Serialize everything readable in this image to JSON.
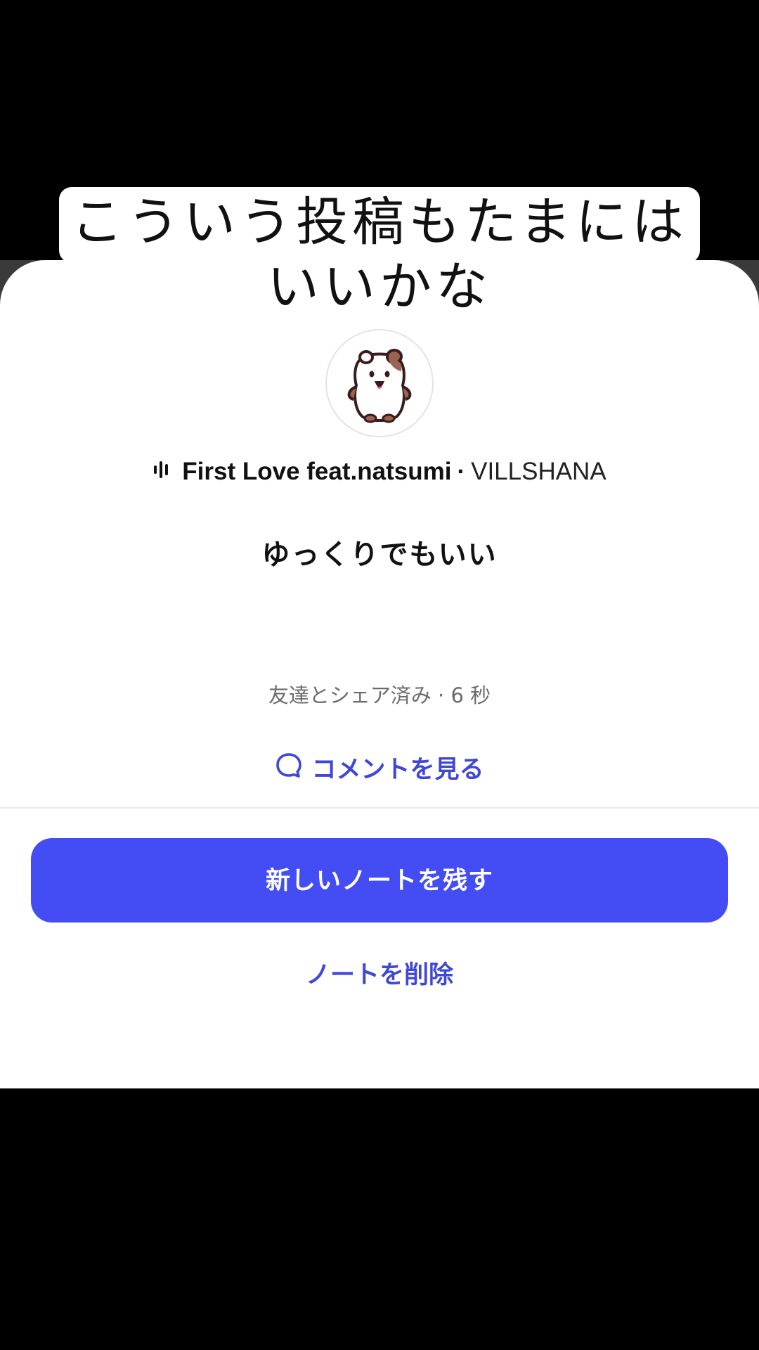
{
  "caption": {
    "line1": "こういう投稿もたまには",
    "line2": "いいかな"
  },
  "music": {
    "icon": "audio-bars-icon",
    "song": "First Love feat.natsumi",
    "separator": "·",
    "artist": "VILLSHANA"
  },
  "note": {
    "text": "ゆっくりでもいい"
  },
  "meta": {
    "text": "友達とシェア済み · 6 秒"
  },
  "actions": {
    "comments_icon": "speech-bubble-icon",
    "comments_label": "コメントを見る",
    "new_note_label": "新しいノートを残す",
    "delete_label": "ノートを削除"
  },
  "colors": {
    "accent": "#444df4",
    "link": "#3f48d6"
  }
}
